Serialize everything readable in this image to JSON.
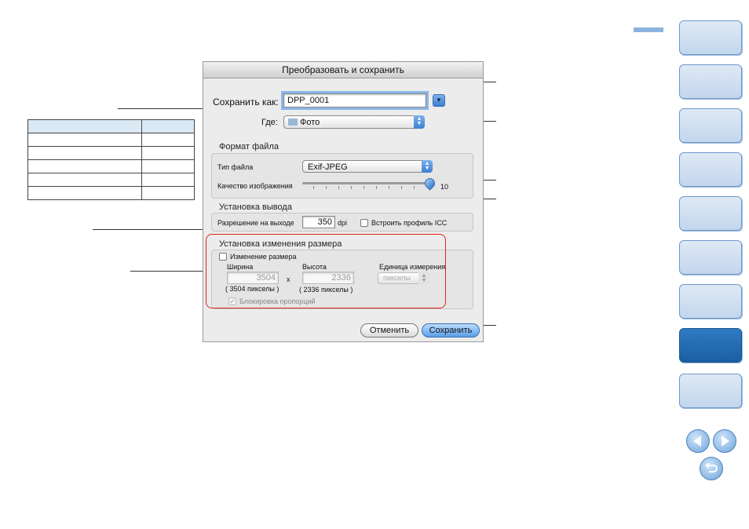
{
  "dialog": {
    "title": "Преобразовать и сохранить",
    "save_as_label": "Сохранить как:",
    "file_name": "DPP_0001",
    "where_label": "Где:",
    "folder": "Фото",
    "file_format": {
      "section": "Формат файла",
      "type_label": "Тип файла",
      "type_value": "Exif-JPEG",
      "quality_label": "Качество изображения",
      "quality_value": "10"
    },
    "output": {
      "section": "Установка вывода",
      "resolution_label": "Разрешение на выходе",
      "resolution_value": "350",
      "resolution_unit": "dpi",
      "icc_label": "Встроить профиль ICC"
    },
    "resize": {
      "section": "Установка изменения размера",
      "resize_label": "Изменение размера",
      "width_label": "Ширина",
      "height_label": "Высота",
      "unit_label": "Единица измерения",
      "width_value": "3504",
      "height_value": "2336",
      "times": "x",
      "width_note": "( 3504 пикселы )",
      "height_note": "( 2336 пикселы )",
      "unit_value": "пикселы",
      "lock_label": "Блокировка пропорций",
      "lock_mark": "✓"
    },
    "cancel_label": "Отменить",
    "save_label": "Сохранить"
  },
  "nav": {
    "tabs_count": 9,
    "active_tab": 8
  },
  "colors": {
    "highlight_box": "#e2231a",
    "nav_tab": "#c2d6ec",
    "nav_active": "#1b5fa2"
  }
}
